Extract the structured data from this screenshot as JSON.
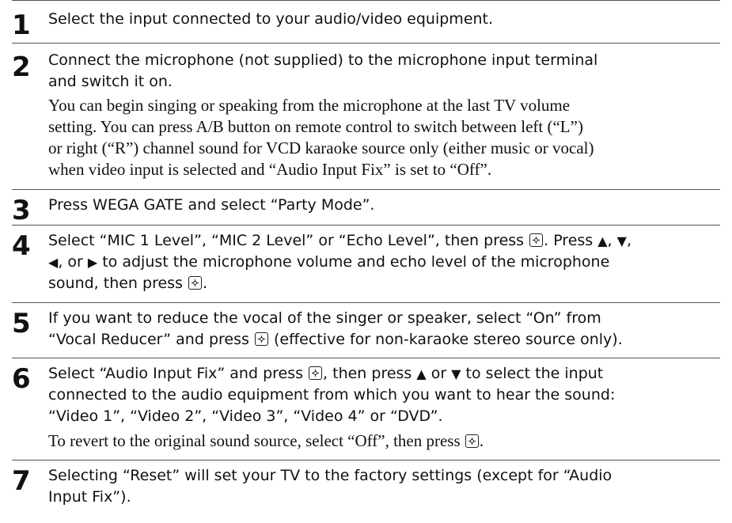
{
  "steps": [
    {
      "number": "1",
      "text": "Select the input connected to your audio/video equipment."
    },
    {
      "number": "2",
      "text_lines": [
        "Connect the microphone (not supplied) to the microphone input terminal",
        "and switch it on."
      ],
      "note_lines": [
        "You can begin singing or speaking from the microphone at the last TV volume",
        "setting. You can press A/B button on remote control to switch between left (“L”)",
        "or right (“R”) channel sound for VCD karaoke source only (either music or vocal)",
        "when video input is selected and “Audio Input Fix” is set to “Off”."
      ]
    },
    {
      "number": "3",
      "text": "Press WEGA GATE and select “Party Mode”."
    },
    {
      "number": "4",
      "line1_a": "Select “MIC 1 Level”, “MIC 2 Level” or “Echo Level”, then press ",
      "line1_b": ". Press ",
      "line1_c": ",",
      "line2_a": ", or ",
      "line2_b": " to adjust the microphone volume and echo level of the microphone",
      "line3_a": "sound, then press ",
      "line3_b": "."
    },
    {
      "number": "5",
      "line1": "If you want to reduce the vocal of the singer or speaker, select “On” from",
      "line2_a": "“Vocal Reducer” and press ",
      "line2_b": " (effective for non-karaoke stereo source only)."
    },
    {
      "number": "6",
      "line1_a": "Select “Audio Input Fix” and press ",
      "line1_b": ", then press ",
      "line1_c": " or ",
      "line1_d": " to select the input",
      "line2": "connected to the audio equipment from which you want to hear the sound:",
      "line3": "“Video 1”, “Video 2”, “Video 3”, “Video 4” or “DVD”.",
      "note_a": "To revert to the original sound source, select “Off”, then press ",
      "note_b": "."
    },
    {
      "number": "7",
      "line1": "Selecting “Reset” will set your TV to the factory settings (except for “Audio",
      "line2": "Input Fix”)."
    }
  ],
  "icons": {
    "up": "▲",
    "down": "▼",
    "left": "◀",
    "right": "▶"
  }
}
